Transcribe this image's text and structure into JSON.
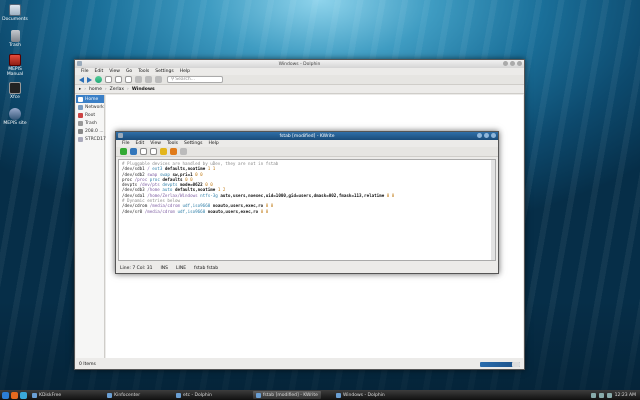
{
  "desktop": {
    "icons": [
      {
        "label": "Documents",
        "icon": "folder-icon"
      },
      {
        "label": "Trash",
        "icon": "trash-icon"
      },
      {
        "label": "MEPIS Manual",
        "icon": "pdf-icon"
      },
      {
        "label": "Xfce",
        "icon": "terminal-icon"
      },
      {
        "label": "MEPIS site",
        "icon": "web-icon"
      }
    ]
  },
  "dolphin": {
    "title": "Windows - Dolphin",
    "menu": [
      "File",
      "Edit",
      "View",
      "Go",
      "Tools",
      "Settings",
      "Help"
    ],
    "search_placeholder": "Search...",
    "breadcrumb": [
      "home",
      "Zerlax",
      "Windows"
    ],
    "places": [
      {
        "label": "Home",
        "active": true
      },
      {
        "label": "Network",
        "active": false
      },
      {
        "label": "Root",
        "active": false
      },
      {
        "label": "Trash",
        "active": false
      },
      {
        "label": "208.0 ...",
        "active": false
      },
      {
        "label": "STRCD17",
        "active": false
      }
    ],
    "status": "0 Items"
  },
  "kwrite": {
    "title": "fstab [modified] - KWrite",
    "menu": [
      "File",
      "Edit",
      "View",
      "Tools",
      "Settings",
      "Help"
    ],
    "lines": [
      [
        {
          "t": "# Pluggable devices are handled by uDev, they are not in fstab",
          "c": "cmt"
        }
      ],
      [
        {
          "t": "/dev/sdb1 ",
          "c": "dev"
        },
        {
          "t": "/ ",
          "c": "mnt"
        },
        {
          "t": "ext3 ",
          "c": "fs"
        },
        {
          "t": "defaults,noatime ",
          "c": "opt"
        },
        {
          "t": "1 1",
          "c": "num"
        }
      ],
      [
        {
          "t": "/dev/sdb2 ",
          "c": "dev"
        },
        {
          "t": "swap ",
          "c": "mnt"
        },
        {
          "t": "swap ",
          "c": "fs"
        },
        {
          "t": "sw,pri=1 ",
          "c": "opt"
        },
        {
          "t": "0 0",
          "c": "num"
        }
      ],
      [
        {
          "t": "proc ",
          "c": "dev"
        },
        {
          "t": "/proc ",
          "c": "mnt"
        },
        {
          "t": "proc ",
          "c": "fs"
        },
        {
          "t": "defaults ",
          "c": "opt"
        },
        {
          "t": "0 0",
          "c": "num"
        }
      ],
      [
        {
          "t": "devpts ",
          "c": "dev"
        },
        {
          "t": "/dev/pts ",
          "c": "mnt"
        },
        {
          "t": "devpts ",
          "c": "fs"
        },
        {
          "t": "mode=0622 ",
          "c": "opt"
        },
        {
          "t": "0 0",
          "c": "num"
        }
      ],
      [
        {
          "t": "/dev/sdb3 ",
          "c": "dev"
        },
        {
          "t": "/home ",
          "c": "mnt"
        },
        {
          "t": "auto ",
          "c": "fs"
        },
        {
          "t": "defaults,noatime ",
          "c": "opt"
        },
        {
          "t": "1 2",
          "c": "num"
        }
      ],
      [
        {
          "t": "/dev/sda1 ",
          "c": "dev"
        },
        {
          "t": "/home/Zerlax/Windows ",
          "c": "mnt"
        },
        {
          "t": "ntfs-3g ",
          "c": "fs"
        },
        {
          "t": "auto,users,noexec,uid=1000,gid=users,dmask=002,fmask=113,relatime ",
          "c": "opt"
        },
        {
          "t": "0 0",
          "c": "num"
        }
      ],
      [
        {
          "t": "# Dynamic entries below",
          "c": "cmt"
        }
      ],
      [
        {
          "t": "/dev/cdrom ",
          "c": "dev"
        },
        {
          "t": "/media/cdrom ",
          "c": "mnt"
        },
        {
          "t": "udf,iso9660 ",
          "c": "fs"
        },
        {
          "t": "noauto,users,exec,ro ",
          "c": "opt"
        },
        {
          "t": "0 0",
          "c": "num"
        }
      ],
      [
        {
          "t": "/dev/sr0 ",
          "c": "dev"
        },
        {
          "t": "/media/cdrom ",
          "c": "mnt"
        },
        {
          "t": "udf,iso9660 ",
          "c": "fs"
        },
        {
          "t": "noauto,users,exec,ro ",
          "c": "opt"
        },
        {
          "t": "0 0",
          "c": "num"
        }
      ]
    ],
    "status": {
      "position": "Line: 7 Col: 31",
      "mode": "INS",
      "line_end": "LINE",
      "file": "fstab fstab"
    }
  },
  "taskbar": {
    "tasks": [
      {
        "label": "KDiskFree",
        "active": false
      },
      {
        "label": "Kinfocenter",
        "active": false
      },
      {
        "label": "etc - Dolphin",
        "active": false
      },
      {
        "label": "fstab [modified] - KWrite",
        "active": true
      },
      {
        "label": "Windows - Dolphin",
        "active": false
      }
    ],
    "clock": "12:23 AM"
  },
  "colors": {
    "accent": "#3b80c7",
    "kwrite_title": "#1a4c7a"
  }
}
